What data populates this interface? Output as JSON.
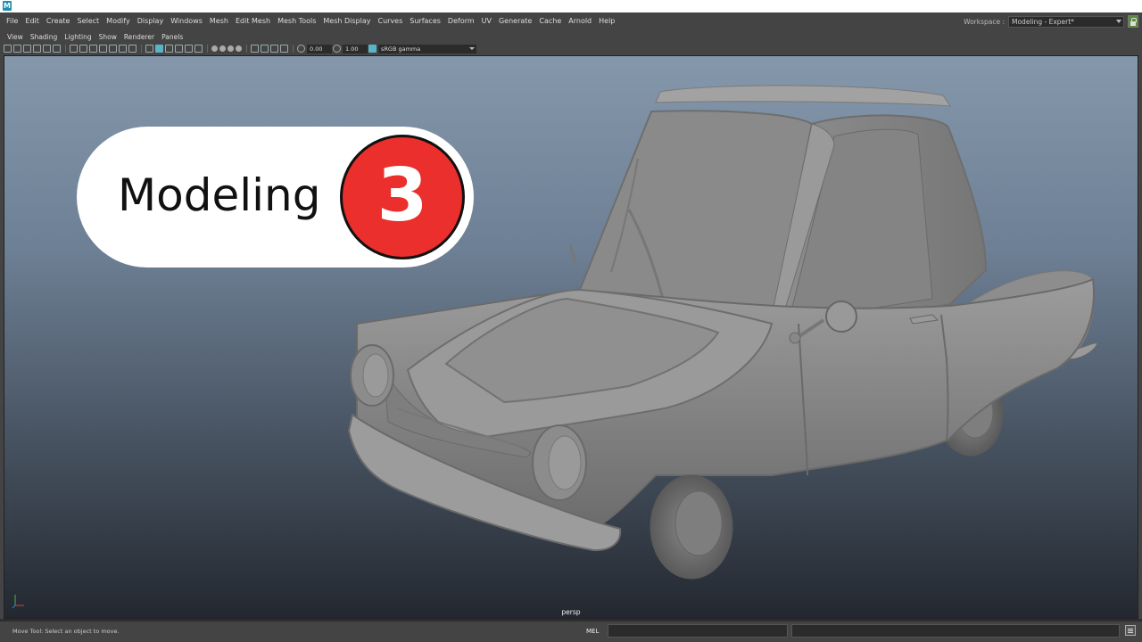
{
  "app": {
    "logo": "M"
  },
  "menubar": {
    "items": [
      "File",
      "Edit",
      "Create",
      "Select",
      "Modify",
      "Display",
      "Windows",
      "Mesh",
      "Edit Mesh",
      "Mesh Tools",
      "Mesh Display",
      "Curves",
      "Surfaces",
      "Deform",
      "UV",
      "Generate",
      "Cache",
      "Arnold",
      "Help"
    ],
    "workspace_label": "Workspace :",
    "workspace_value": "Modeling - Expert*",
    "lock_icon": "lock-icon"
  },
  "panel_menu": {
    "items": [
      "View",
      "Shading",
      "Lighting",
      "Show",
      "Renderer",
      "Panels"
    ]
  },
  "panel_toolbar": {
    "exposure": "0.00",
    "gamma": "1.00",
    "color_space": "sRGB gamma"
  },
  "viewport": {
    "camera": "persp",
    "mesh": "cartoon-car-model"
  },
  "overlay": {
    "title": "Modeling",
    "number": "3",
    "number_color": "#ea2f2c"
  },
  "statusbar": {
    "help": "Move Tool: Select an object to move.",
    "mel_label": "MEL"
  }
}
